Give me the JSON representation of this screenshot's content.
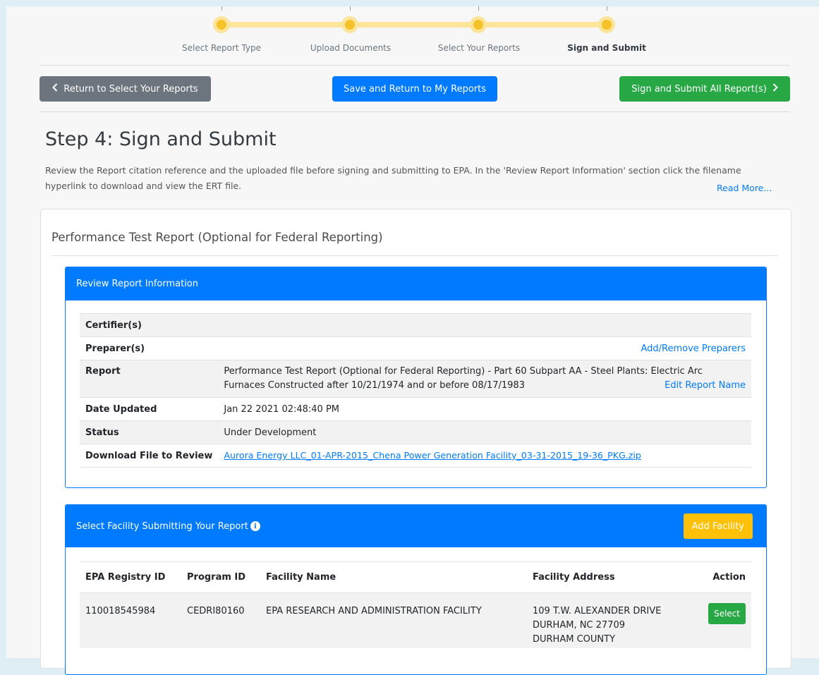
{
  "stepper": {
    "steps": [
      {
        "label": "Select Report Type"
      },
      {
        "label": "Upload Documents"
      },
      {
        "label": "Select Your Reports"
      },
      {
        "label": "Sign and Submit"
      }
    ]
  },
  "nav": {
    "back_label": "Return to Select Your Reports",
    "save_label": "Save and Return to My Reports",
    "submit_label": "Sign and Submit All Report(s)"
  },
  "page": {
    "title": "Step 4: Sign and Submit",
    "intro": "Review the Report citation reference and the uploaded file before signing and submitting to EPA. In the 'Review Report Information' section click the filename hyperlink to download and view the ERT file.",
    "read_more": "Read More..."
  },
  "card": {
    "title": "Performance Test Report (Optional for Federal Reporting)"
  },
  "review": {
    "header": "Review Report Information",
    "certifiers_label": "Certifier(s)",
    "preparers_label": "Preparer(s)",
    "add_remove_preparers": "Add/Remove Preparers",
    "report_label": "Report",
    "report_value": "Performance Test Report (Optional for Federal Reporting) - Part 60 Subpart AA - Steel Plants: Electric Arc Furnaces Constructed after 10/21/1974 and or before 08/17/1983",
    "edit_report_name": "Edit Report Name",
    "date_label": "Date Updated",
    "date_value": "Jan 22 2021 02:48:40 PM",
    "status_label": "Status",
    "status_value": "Under Development",
    "download_label": "Download File to Review",
    "download_file": "Aurora Energy LLC_01-APR-2015_Chena Power Generation Facility_03-31-2015_19-36_PKG.zip"
  },
  "facility": {
    "header": "Select Facility Submitting Your Report",
    "add_button": "Add Facility",
    "columns": [
      "EPA Registry ID",
      "Program ID",
      "Facility Name",
      "Facility Address",
      "Action"
    ],
    "rows": [
      {
        "registry_id": "110018545984",
        "program_id": "CEDRI80160",
        "name": "EPA RESEARCH AND ADMINISTRATION FACILITY",
        "address_line1": "109 T.W. ALEXANDER DRIVE",
        "address_line2": "DURHAM, NC 27709",
        "address_line3": "DURHAM COUNTY",
        "action": "Select"
      }
    ]
  },
  "colors": {
    "primary": "#007bff",
    "success": "#28a745",
    "secondary": "#6c757d",
    "warning": "#ffc107",
    "step_dot": "#f6c22a"
  },
  "icons": {
    "back": "chevron-left-icon",
    "submit": "chevron-right-icon",
    "info": "info-circle-icon"
  }
}
